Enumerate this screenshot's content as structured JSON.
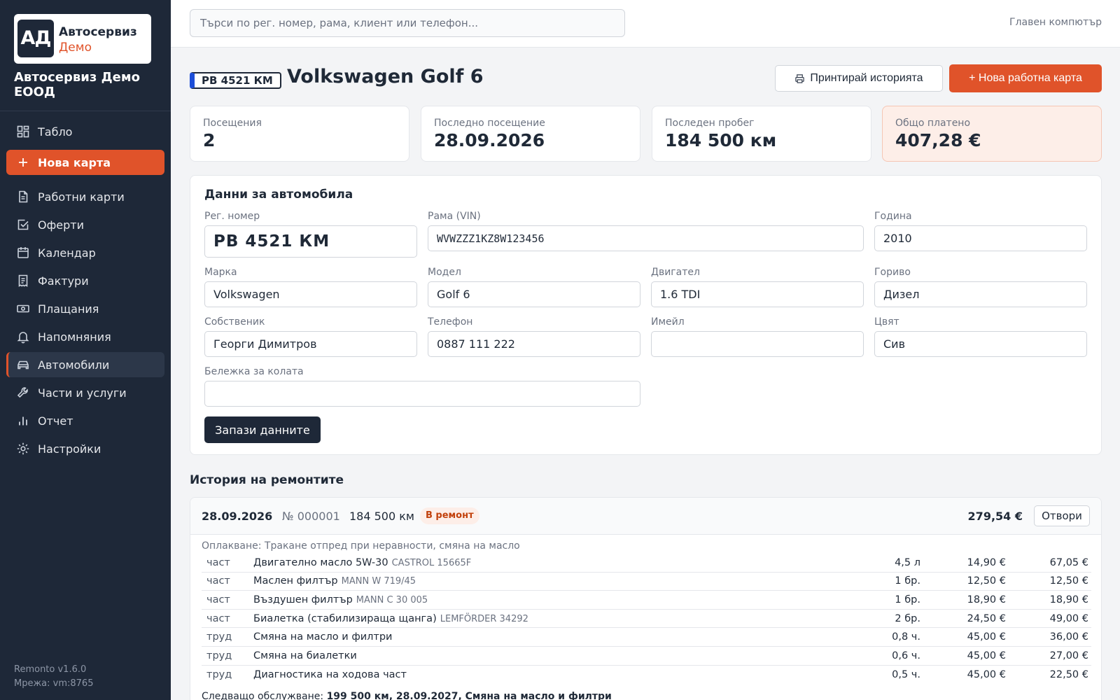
{
  "brand": {
    "mark": "АД",
    "line1": "Автосервиз",
    "line2": "Демо",
    "company": "Автосервиз Демо ЕООД",
    "accent": "#e0532a",
    "sidebar_bg": "#1e2838"
  },
  "nav": [
    {
      "label": "Табло",
      "icon": "dashboard-icon"
    },
    {
      "label": "Нова карта",
      "icon": "plus-icon"
    },
    {
      "label": "Работни карти",
      "icon": "document-icon"
    },
    {
      "label": "Оферти",
      "icon": "checkbox-icon"
    },
    {
      "label": "Календар",
      "icon": "calendar-icon"
    },
    {
      "label": "Фактури",
      "icon": "receipt-icon"
    },
    {
      "label": "Плащания",
      "icon": "cash-icon"
    },
    {
      "label": "Напомняния",
      "icon": "bell-icon"
    },
    {
      "label": "Автомобили",
      "icon": "car-icon"
    },
    {
      "label": "Части и услуги",
      "icon": "wrench-icon"
    },
    {
      "label": "Отчет",
      "icon": "bar-chart-icon"
    },
    {
      "label": "Настройки",
      "icon": "gear-icon"
    }
  ],
  "footer": {
    "version": "Remonto v1.6.0",
    "network": "Мрежа: vm:8765"
  },
  "topbar": {
    "search_placeholder": "Търси по рег. номер, рама, клиент или телефон...",
    "computer": "Главен компютър"
  },
  "header": {
    "plate": "РВ 4521 КМ",
    "title": "Volkswagen Golf 6",
    "print_label": "Принтирай историята",
    "new_label": "+ Нова работна карта"
  },
  "stats": [
    {
      "label": "Посещения",
      "value": "2"
    },
    {
      "label": "Последно посещение",
      "value": "28.09.2026"
    },
    {
      "label": "Последен пробег",
      "value": "184 500 км"
    },
    {
      "label": "Общо платено",
      "value": "407,28 €"
    }
  ],
  "vehicle": {
    "title": "Данни за автомобила",
    "fields": {
      "reg": {
        "label": "Рег. номер",
        "value": "РВ 4521 КМ"
      },
      "vin": {
        "label": "Рама (VIN)",
        "value": "WVWZZZ1KZ8W123456"
      },
      "year": {
        "label": "Година",
        "value": "2010"
      },
      "make": {
        "label": "Марка",
        "value": "Volkswagen"
      },
      "model": {
        "label": "Модел",
        "value": "Golf 6"
      },
      "engine": {
        "label": "Двигател",
        "value": "1.6 TDI"
      },
      "fuel": {
        "label": "Гориво",
        "value": "Дизел"
      },
      "owner": {
        "label": "Собственик",
        "value": "Георги Димитров"
      },
      "phone": {
        "label": "Телефон",
        "value": "0887 111 222"
      },
      "email": {
        "label": "Имейл",
        "value": ""
      },
      "color": {
        "label": "Цвят",
        "value": "Сив"
      },
      "note": {
        "label": "Бележка за колата",
        "value": ""
      }
    },
    "save_label": "Запази данните"
  },
  "history": {
    "title": "История на ремонтите",
    "entries": [
      {
        "date": "28.09.2026",
        "number": "№ 000001",
        "km": "184 500 км",
        "status": "В ремонт",
        "total": "279,54 €",
        "open_label": "Отвори",
        "complaint": "Оплакване: Тракане отпред при неравности, смяна на масло",
        "items": [
          {
            "type": "част",
            "name": "Двигателно масло 5W-30",
            "code": "CASTROL 15665F",
            "qty": "4,5 л",
            "price": "14,90 €",
            "sum": "67,05 €"
          },
          {
            "type": "част",
            "name": "Маслен филтър",
            "code": "MANN W 719/45",
            "qty": "1 бр.",
            "price": "12,50 €",
            "sum": "12,50 €"
          },
          {
            "type": "част",
            "name": "Въздушен филтър",
            "code": "MANN C 30 005",
            "qty": "1 бр.",
            "price": "18,90 €",
            "sum": "18,90 €"
          },
          {
            "type": "част",
            "name": "Биалетка (стабилизираща щанга)",
            "code": "LEMFÖRDER 34292",
            "qty": "2 бр.",
            "price": "24,50 €",
            "sum": "49,00 €"
          },
          {
            "type": "труд",
            "name": "Смяна на масло и филтри",
            "code": "",
            "qty": "0,8 ч.",
            "price": "45,00 €",
            "sum": "36,00 €"
          },
          {
            "type": "труд",
            "name": "Смяна на биалетки",
            "code": "",
            "qty": "0,6 ч.",
            "price": "45,00 €",
            "sum": "27,00 €"
          },
          {
            "type": "труд",
            "name": "Диагностика на ходова част",
            "code": "",
            "qty": "0,5 ч.",
            "price": "45,00 €",
            "sum": "22,50 €"
          }
        ],
        "next_label": "Следващо обслужване:",
        "next_value": "199 500 км, 28.09.2027, Смяна на масло и филтри"
      }
    ]
  }
}
